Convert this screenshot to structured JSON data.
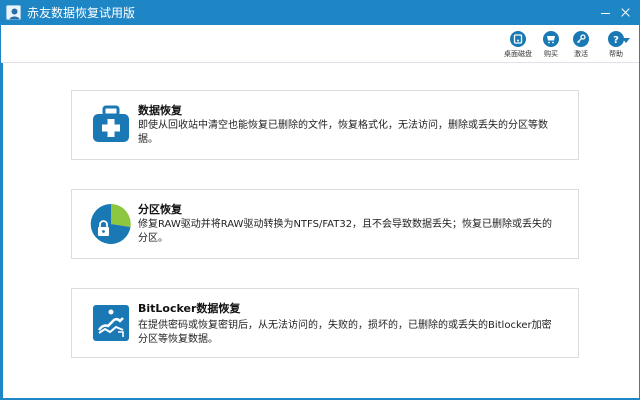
{
  "window": {
    "title": "赤友数据恢复试用版"
  },
  "toolbar": {
    "items": [
      {
        "label": "桌面磁盘",
        "icon": "disk-icon"
      },
      {
        "label": "购买",
        "icon": "cart-icon"
      },
      {
        "label": "激活",
        "icon": "key-icon"
      },
      {
        "label": "帮助",
        "icon": "help-icon"
      }
    ]
  },
  "cards": [
    {
      "title": "数据恢复",
      "desc": "即使从回收站中清空也能恢复已删除的文件，恢复格式化，无法访问，删除或丢失的分区等数据。",
      "icon": "medical-kit-icon"
    },
    {
      "title": "分区恢复",
      "desc": "修复RAW驱动并将RAW驱动转换为NTFS/FAT32，且不会导致数据丢失；恢复已删除或丢失的分区。",
      "icon": "partition-pie-icon"
    },
    {
      "title": "BitLocker数据恢复",
      "desc": "在提供密码或恢复密钥后，从无法访问的，失败的，损坏的，已删除的或丢失的Bitlocker加密分区等恢复数据。",
      "icon": "bitlocker-key-icon"
    }
  ],
  "colors": {
    "accent": "#1f86c6",
    "icon_blue": "#1a78b4",
    "pie_green": "#8dc63f"
  }
}
